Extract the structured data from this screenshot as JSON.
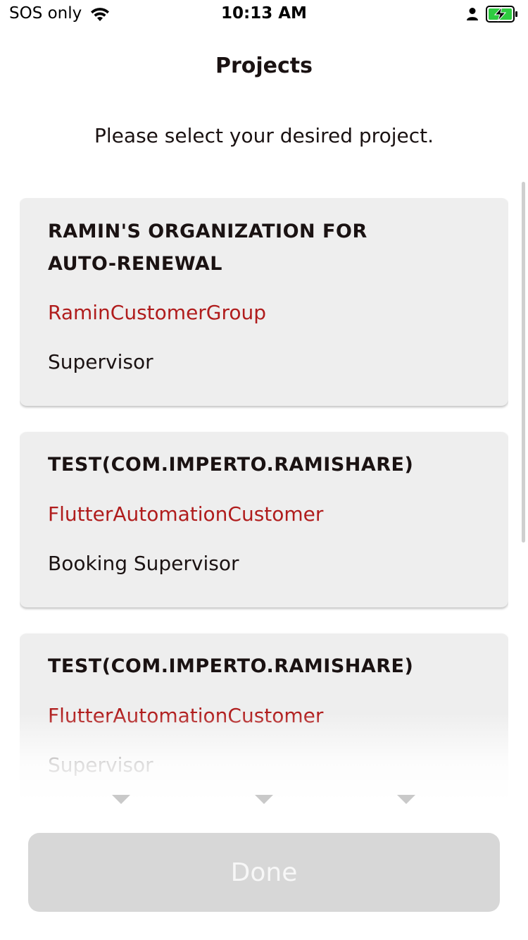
{
  "status_bar": {
    "carrier": "SOS only",
    "time": "10:13 AM",
    "battery_color": "#2ecc40"
  },
  "header": {
    "title": "Projects",
    "subtitle": "Please select your desired project."
  },
  "projects": [
    {
      "title": "RAMIN'S ORGANIZATION FOR AUTO-RENEWAL",
      "group": "RaminCustomerGroup",
      "role": "Supervisor"
    },
    {
      "title": "TEST(COM.IMPERTO.RAMISHARE)",
      "group": "FlutterAutomationCustomer",
      "role": "Booking Supervisor"
    },
    {
      "title": "TEST(COM.IMPERTO.RAMISHARE)",
      "group": "FlutterAutomationCustomer",
      "role": "Supervisor"
    }
  ],
  "footer": {
    "done_label": "Done"
  },
  "colors": {
    "accent_red": "#b01c1c",
    "card_bg": "#eeeeee",
    "button_disabled": "#d7d7d7"
  },
  "icons": [
    "wifi-icon",
    "person-icon",
    "battery-charging-icon",
    "chevron-down-icon"
  ]
}
